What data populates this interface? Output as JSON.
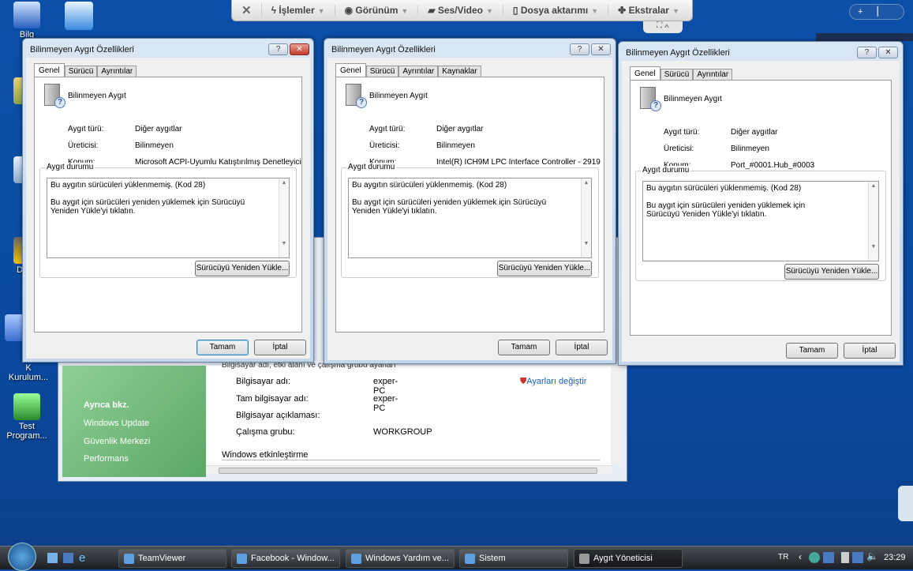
{
  "desktop": {
    "icons": [
      "Bilg",
      "e",
      "Dö",
      "Drive",
      "K\nKurulum...",
      "Test\nProgram..."
    ]
  },
  "teamviewer_toolbar": {
    "items": [
      "İşlemler",
      "Görünüm",
      "Ses/Video",
      "Dosya aktarımı",
      "Ekstralar"
    ],
    "close": "✕"
  },
  "system_window": {
    "see_also": "Ayrıca bkz.",
    "links": [
      "Windows Update",
      "Güvenlik Merkezi",
      "Performans"
    ],
    "section_header": "Bilgisayar adı, etki alanı ve çalışma grubu ayarları",
    "rows": [
      {
        "label": "Bilgisayar adı:",
        "value": "exper-PC"
      },
      {
        "label": "Tam bilgisayar adı:",
        "value": "exper-PC"
      },
      {
        "label": "Bilgisayar açıklaması:",
        "value": ""
      },
      {
        "label": "Çalışma grubu:",
        "value": "WORKGROUP"
      }
    ],
    "change_settings": "Ayarları değiştir",
    "activation": "Windows etkinleştirme"
  },
  "dialogs": [
    {
      "title": "Bilinmeyen Aygıt Özellikleri",
      "tabs": [
        "Genel",
        "Sürücü",
        "Ayrıntılar"
      ],
      "device": "Bilinmeyen Aygıt",
      "labels": [
        "Aygıt türü:",
        "Üreticisi:",
        "Konum:"
      ],
      "values": [
        "Diğer aygıtlar",
        "Bilinmeyen",
        "Microsoft ACPI-Uyumlu Katıştırılmış Denetleyici"
      ],
      "status_label": "Aygıt durumu",
      "status_line1": "Bu aygıtın sürücüleri yüklenmemiş. (Kod 28)",
      "status_line2": "Bu aygıt için sürücüleri yeniden yüklemek için Sürücüyü Yeniden Yükle'yi tıklatın.",
      "reinstall": "Sürücüyü Yeniden Yükle...",
      "ok": "Tamam",
      "cancel": "İptal"
    },
    {
      "title": "Bilinmeyen Aygıt Özellikleri",
      "tabs": [
        "Genel",
        "Sürücü",
        "Ayrıntılar",
        "Kaynaklar"
      ],
      "device": "Bilinmeyen Aygıt",
      "labels": [
        "Aygıt türü:",
        "Üreticisi:",
        "Konum:"
      ],
      "values": [
        "Diğer aygıtlar",
        "Bilinmeyen",
        "Intel(R) ICH9M LPC Interface Controller - 2919"
      ],
      "status_label": "Aygıt durumu",
      "status_line1": "Bu aygıtın sürücüleri yüklenmemiş. (Kod 28)",
      "status_line2": "Bu aygıt için sürücüleri yeniden yüklemek için Sürücüyü Yeniden Yükle'yi tıklatın.",
      "reinstall": "Sürücüyü Yeniden Yükle...",
      "ok": "Tamam",
      "cancel": "İptal"
    },
    {
      "title": "Bilinmeyen Aygıt Özellikleri",
      "tabs": [
        "Genel",
        "Sürücü",
        "Ayrıntılar"
      ],
      "device": "Bilinmeyen Aygıt",
      "labels": [
        "Aygıt türü:",
        "Üreticisi:",
        "Konum:"
      ],
      "values": [
        "Diğer aygıtlar",
        "Bilinmeyen",
        "Port_#0001.Hub_#0003"
      ],
      "status_label": "Aygıt durumu",
      "status_line1": "Bu aygıtın sürücüleri yüklenmemiş. (Kod 28)",
      "status_line2": "Bu aygıt için sürücüleri yeniden yüklemek için Sürücüyü Yeniden Yükle'yi tıklatın.",
      "reinstall": "Sürücüyü Yeniden Yükle...",
      "ok": "Tamam",
      "cancel": "İptal"
    }
  ],
  "taskbar": {
    "buttons": [
      "TeamViewer",
      "Facebook - Window...",
      "Windows Yardım ve...",
      "Sistem",
      "Aygıt Yöneticisi"
    ],
    "active": "Aygıt Yöneticisi",
    "language": "TR",
    "clock": "23:29"
  }
}
